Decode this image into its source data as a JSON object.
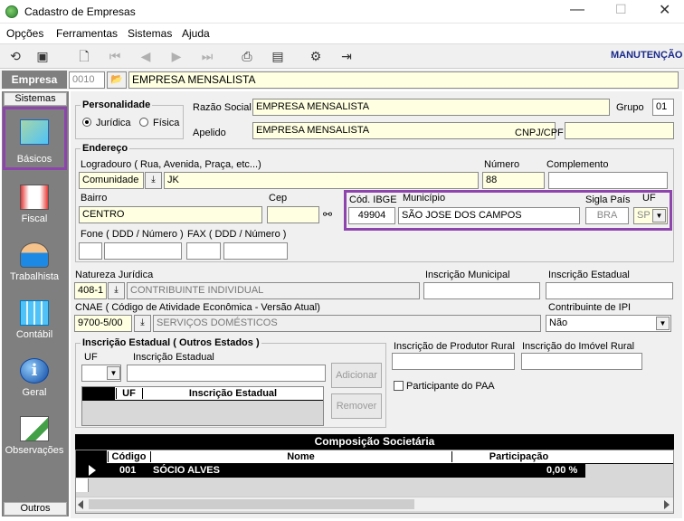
{
  "window": {
    "title": "Cadastro de Empresas"
  },
  "menu": {
    "items": [
      "Opções",
      "Ferramentas",
      "Sistemas",
      "Ajuda"
    ]
  },
  "toolbar": {
    "mode": "MANUTENÇÃO"
  },
  "empresa": {
    "label": "Empresa",
    "code": "0010",
    "name": "EMPRESA MENSALISTA"
  },
  "sidebar": {
    "top": "Sistemas",
    "bottom": "Outros",
    "items": [
      "Básicos",
      "Fiscal",
      "Trabalhista",
      "Contábil",
      "Geral",
      "Observações"
    ]
  },
  "personalidade": {
    "title": "Personalidade",
    "juridica": "Jurídica",
    "fisica": "Física"
  },
  "razao": {
    "label": "Razão Social",
    "value": "EMPRESA MENSALISTA"
  },
  "grupo": {
    "label": "Grupo",
    "value": "01"
  },
  "apelido": {
    "label": "Apelido",
    "value": "EMPRESA MENSALISTA"
  },
  "cnpj": {
    "label": "CNPJ/CPF",
    "value": ""
  },
  "endereco": {
    "title": "Endereço",
    "logradouro_label": "Logradouro ( Rua, Avenida, Praça, etc...)",
    "tipo": "Comunidade",
    "logradouro": "JK",
    "numero_label": "Número",
    "numero": "88",
    "complemento_label": "Complemento",
    "bairro_label": "Bairro",
    "bairro": "CENTRO",
    "cep_label": "Cep",
    "ibge_label": "Cód. IBGE",
    "ibge": "49904",
    "municipio_label": "Município",
    "municipio": "SÃO JOSE DOS CAMPOS",
    "sigla_label": "Sigla País",
    "sigla": "BRA",
    "uf_label": "UF",
    "uf": "SP",
    "fone_label": "Fone ( DDD / Número )",
    "fax_label": "FAX ( DDD / Número )"
  },
  "natureza": {
    "label": "Natureza Jurídica",
    "code": "408-1",
    "desc": "CONTRIBUINTE INDIVIDUAL"
  },
  "inscmun": {
    "label": "Inscrição Municipal"
  },
  "inscest": {
    "label": "Inscrição Estadual"
  },
  "cnae": {
    "label": "CNAE ( Código de Atividade Econômica - Versão Atual)",
    "code": "9700-5/00",
    "desc": "SERVIÇOS DOMÉSTICOS"
  },
  "ipi": {
    "label": "Contribuinte de IPI",
    "value": "Não"
  },
  "outros": {
    "title": "Inscrição Estadual ( Outros Estados )",
    "uf_label": "UF",
    "insc_label": "Inscrição Estadual",
    "add": "Adicionar",
    "remove": "Remover",
    "col_uf": "UF",
    "col_insc": "Inscrição Estadual"
  },
  "rural": {
    "label": "Inscrição de Produtor Rural"
  },
  "imovel": {
    "label": "Inscrição do Imóvel Rural"
  },
  "paa": {
    "label": "Participante do PAA"
  },
  "socios": {
    "title": "Composição Societária",
    "col_codigo": "Código",
    "col_nome": "Nome",
    "col_part": "Participação",
    "row_codigo": "001",
    "row_nome": "SÓCIO ALVES",
    "row_part": "0,00 %"
  },
  "colors": {
    "sidebar": "#7f7f7f",
    "highlight": "#8e44ad",
    "titlebar_bg": "#ffffff",
    "field": "#ffffe1",
    "grid_header": "#000000"
  }
}
